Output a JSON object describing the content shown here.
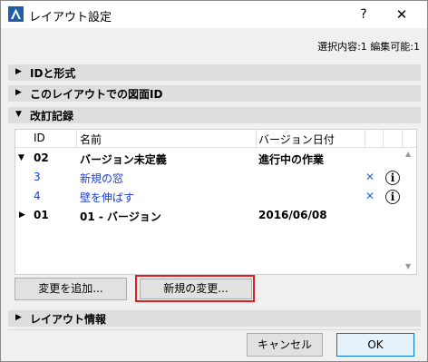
{
  "window": {
    "title": "レイアウト設定",
    "help_label": "?",
    "close_label": "✕"
  },
  "status": {
    "selection": "選択内容:1 編集可能:1"
  },
  "sections": {
    "id_format": "IDと形式",
    "drawing_id": "このレイアウトでの図面ID",
    "revision_history": "改訂記録",
    "layout_info": "レイアウト情報"
  },
  "table": {
    "columns": {
      "id": "ID",
      "name": "名前",
      "version_date": "バージョン日付"
    },
    "rows": [
      {
        "id": "02",
        "name": "バージョン未定義",
        "date": "進行中の作業"
      },
      {
        "id": "3",
        "name": "新規の窓"
      },
      {
        "id": "4",
        "name": "壁を伸ばす"
      },
      {
        "id": "01",
        "name": "01 - バージョン",
        "date": "2016/06/08"
      }
    ]
  },
  "buttons": {
    "add_change": "変更を追加...",
    "new_change": "新規の変更...",
    "cancel": "キャンセル",
    "ok": "OK"
  },
  "icons": {
    "expand": "▶",
    "collapse": "▼",
    "delete": "✕",
    "info": "i"
  },
  "colors": {
    "highlight": "#e02020",
    "link": "#1a3bd6",
    "delete": "#2a6fd6"
  }
}
